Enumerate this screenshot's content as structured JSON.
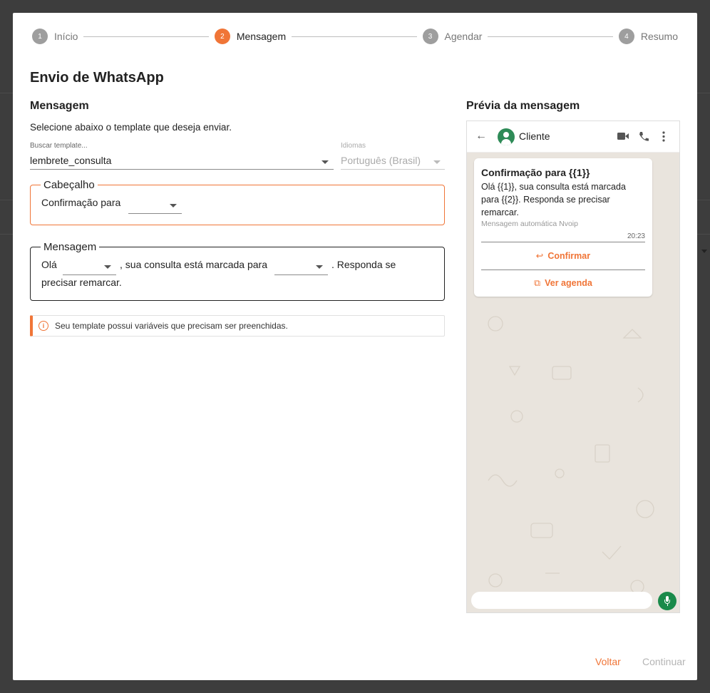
{
  "stepper": {
    "steps": [
      {
        "num": "1",
        "label": "Início"
      },
      {
        "num": "2",
        "label": "Mensagem"
      },
      {
        "num": "3",
        "label": "Agendar"
      },
      {
        "num": "4",
        "label": "Resumo"
      }
    ],
    "active_step": 2
  },
  "title": "Envio de WhatsApp",
  "message_section": {
    "title": "Mensagem",
    "subtitle": "Selecione abaixo o template que deseja enviar."
  },
  "template_field": {
    "label": "Buscar template...",
    "value": "lembrete_consulta"
  },
  "language_field": {
    "label": "Idiomas",
    "value": "Português (Brasil)"
  },
  "header_fieldset": {
    "legend": "Cabeçalho",
    "text": "Confirmação para"
  },
  "body_fieldset": {
    "legend": "Mensagem",
    "text_1": "Olá",
    "text_2": ", sua consulta está marcada para",
    "text_3": ". Responda se",
    "text_4": "precisar remarcar."
  },
  "alert": {
    "icon": "info-icon",
    "text": "Seu template possui variáveis que precisam ser preenchidas."
  },
  "preview": {
    "title": "Prévia da mensagem",
    "contact_name": "Cliente",
    "bubble": {
      "title": "Confirmação para {{1}}",
      "body": "Olá {{1}}, sua consulta está marcada para {{2}}. Responda se precisar remarcar.",
      "footer": "Mensagem automática Nvoip",
      "time": "20:23",
      "buttons": [
        {
          "icon": "reply-icon",
          "label": "Confirmar"
        },
        {
          "icon": "external-link-icon",
          "label": "Ver agenda"
        }
      ]
    }
  },
  "actions": {
    "back_label": "Voltar",
    "continue_label": "Continuar"
  },
  "colors": {
    "accent": "#f07537",
    "whatsapp_green": "#1a8a4a",
    "chat_bg": "#e9e4dd"
  }
}
